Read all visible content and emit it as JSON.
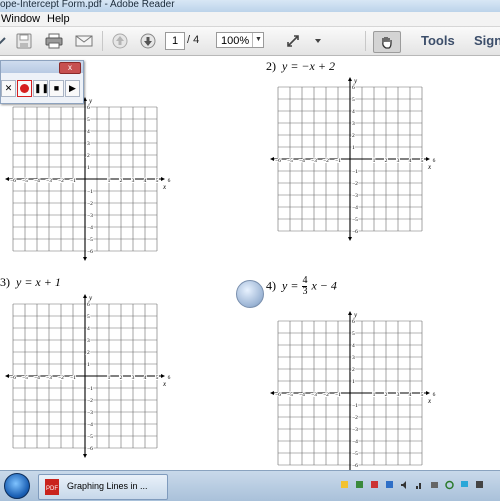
{
  "window": {
    "title": "ope-Intercept Form.pdf - Adobe Reader"
  },
  "menu": [
    "Window",
    "Help"
  ],
  "toolbar": {
    "page_current": "1",
    "page_total": "/ 4",
    "zoom": "100%",
    "tools_label": "Tools",
    "sign_label": "Sign"
  },
  "problems": [
    {
      "number": "2)",
      "equation": "y = −x + 2"
    },
    {
      "number": "3)",
      "equation": "y = x + 1"
    },
    {
      "number": "4)",
      "equation_prefix": "y =",
      "frac_num": "4",
      "frac_den": "3",
      "equation_suffix": "x − 4"
    }
  ],
  "axis": {
    "x_label": "x",
    "y_label": "y",
    "x_ticks_neg": [
      "−6",
      "−5",
      "−4",
      "−3",
      "−2",
      "−1"
    ],
    "x_ticks_pos": [
      "1",
      "2",
      "3",
      "4",
      "5",
      "6"
    ],
    "y_ticks_pos": [
      "6",
      "5",
      "4",
      "3",
      "2",
      "1"
    ],
    "y_ticks_neg": [
      "−1",
      "−2",
      "−3",
      "−4",
      "−5",
      "−6"
    ]
  },
  "recorder": {
    "close_label": "x"
  },
  "taskbar": {
    "task_label": "Graphing Lines in ..."
  },
  "colors": {
    "record": "#d61f1f",
    "titlebar": "#bcd3ea",
    "toolbar_text": "#3c4e6a",
    "grid": "#555555"
  }
}
